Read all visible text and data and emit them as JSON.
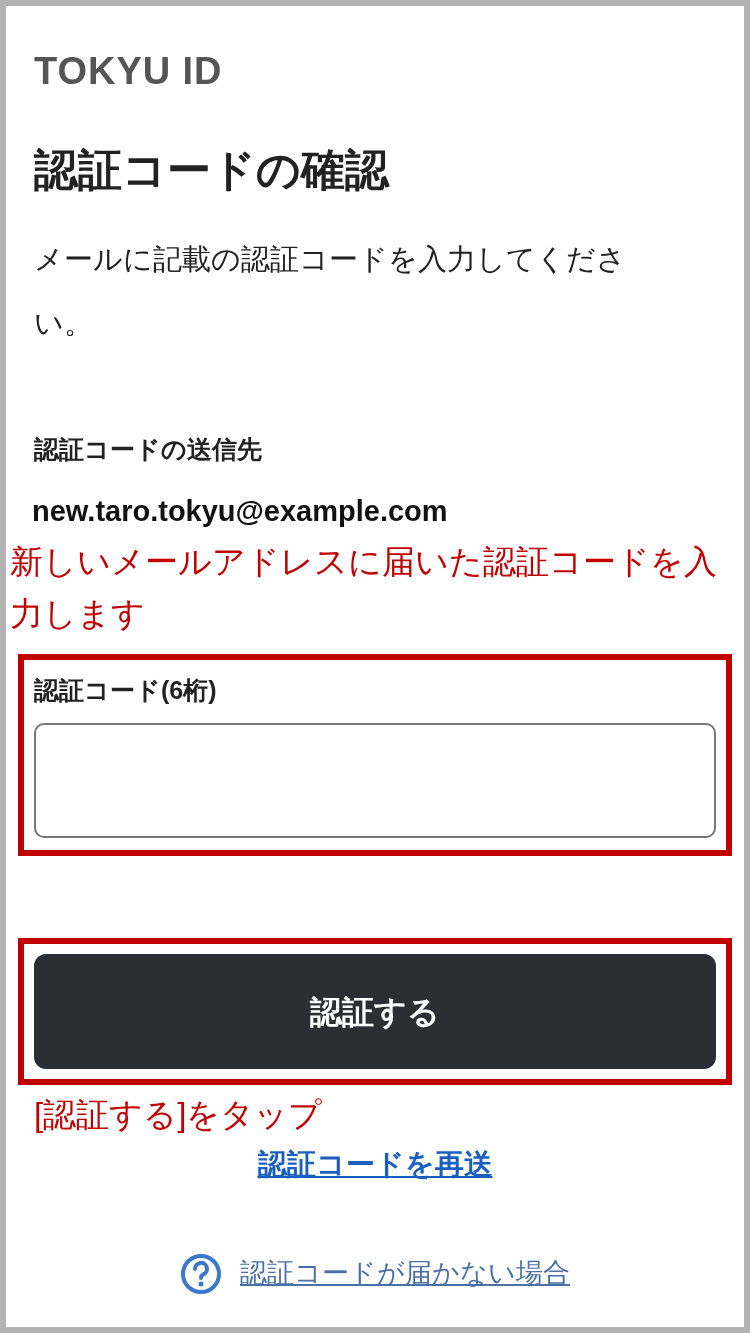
{
  "logo": "TOKYU ID",
  "title": "認証コードの確認",
  "instruction": "メールに記載の認証コードを入力してください。",
  "destination": {
    "label": "認証コードの送信先",
    "email": "new.taro.tokyu@example.com"
  },
  "annotations": [
    {
      "text": "新しいメールアドレスに届いた認証コードを入力します"
    },
    {
      "text": "[認証する]をタップ"
    }
  ],
  "code_field": {
    "label": "認証コード(6桁)"
  },
  "submit_button": "認証する",
  "resend_link": "認証コードを再送",
  "help_link": "認証コードが届かない場合"
}
